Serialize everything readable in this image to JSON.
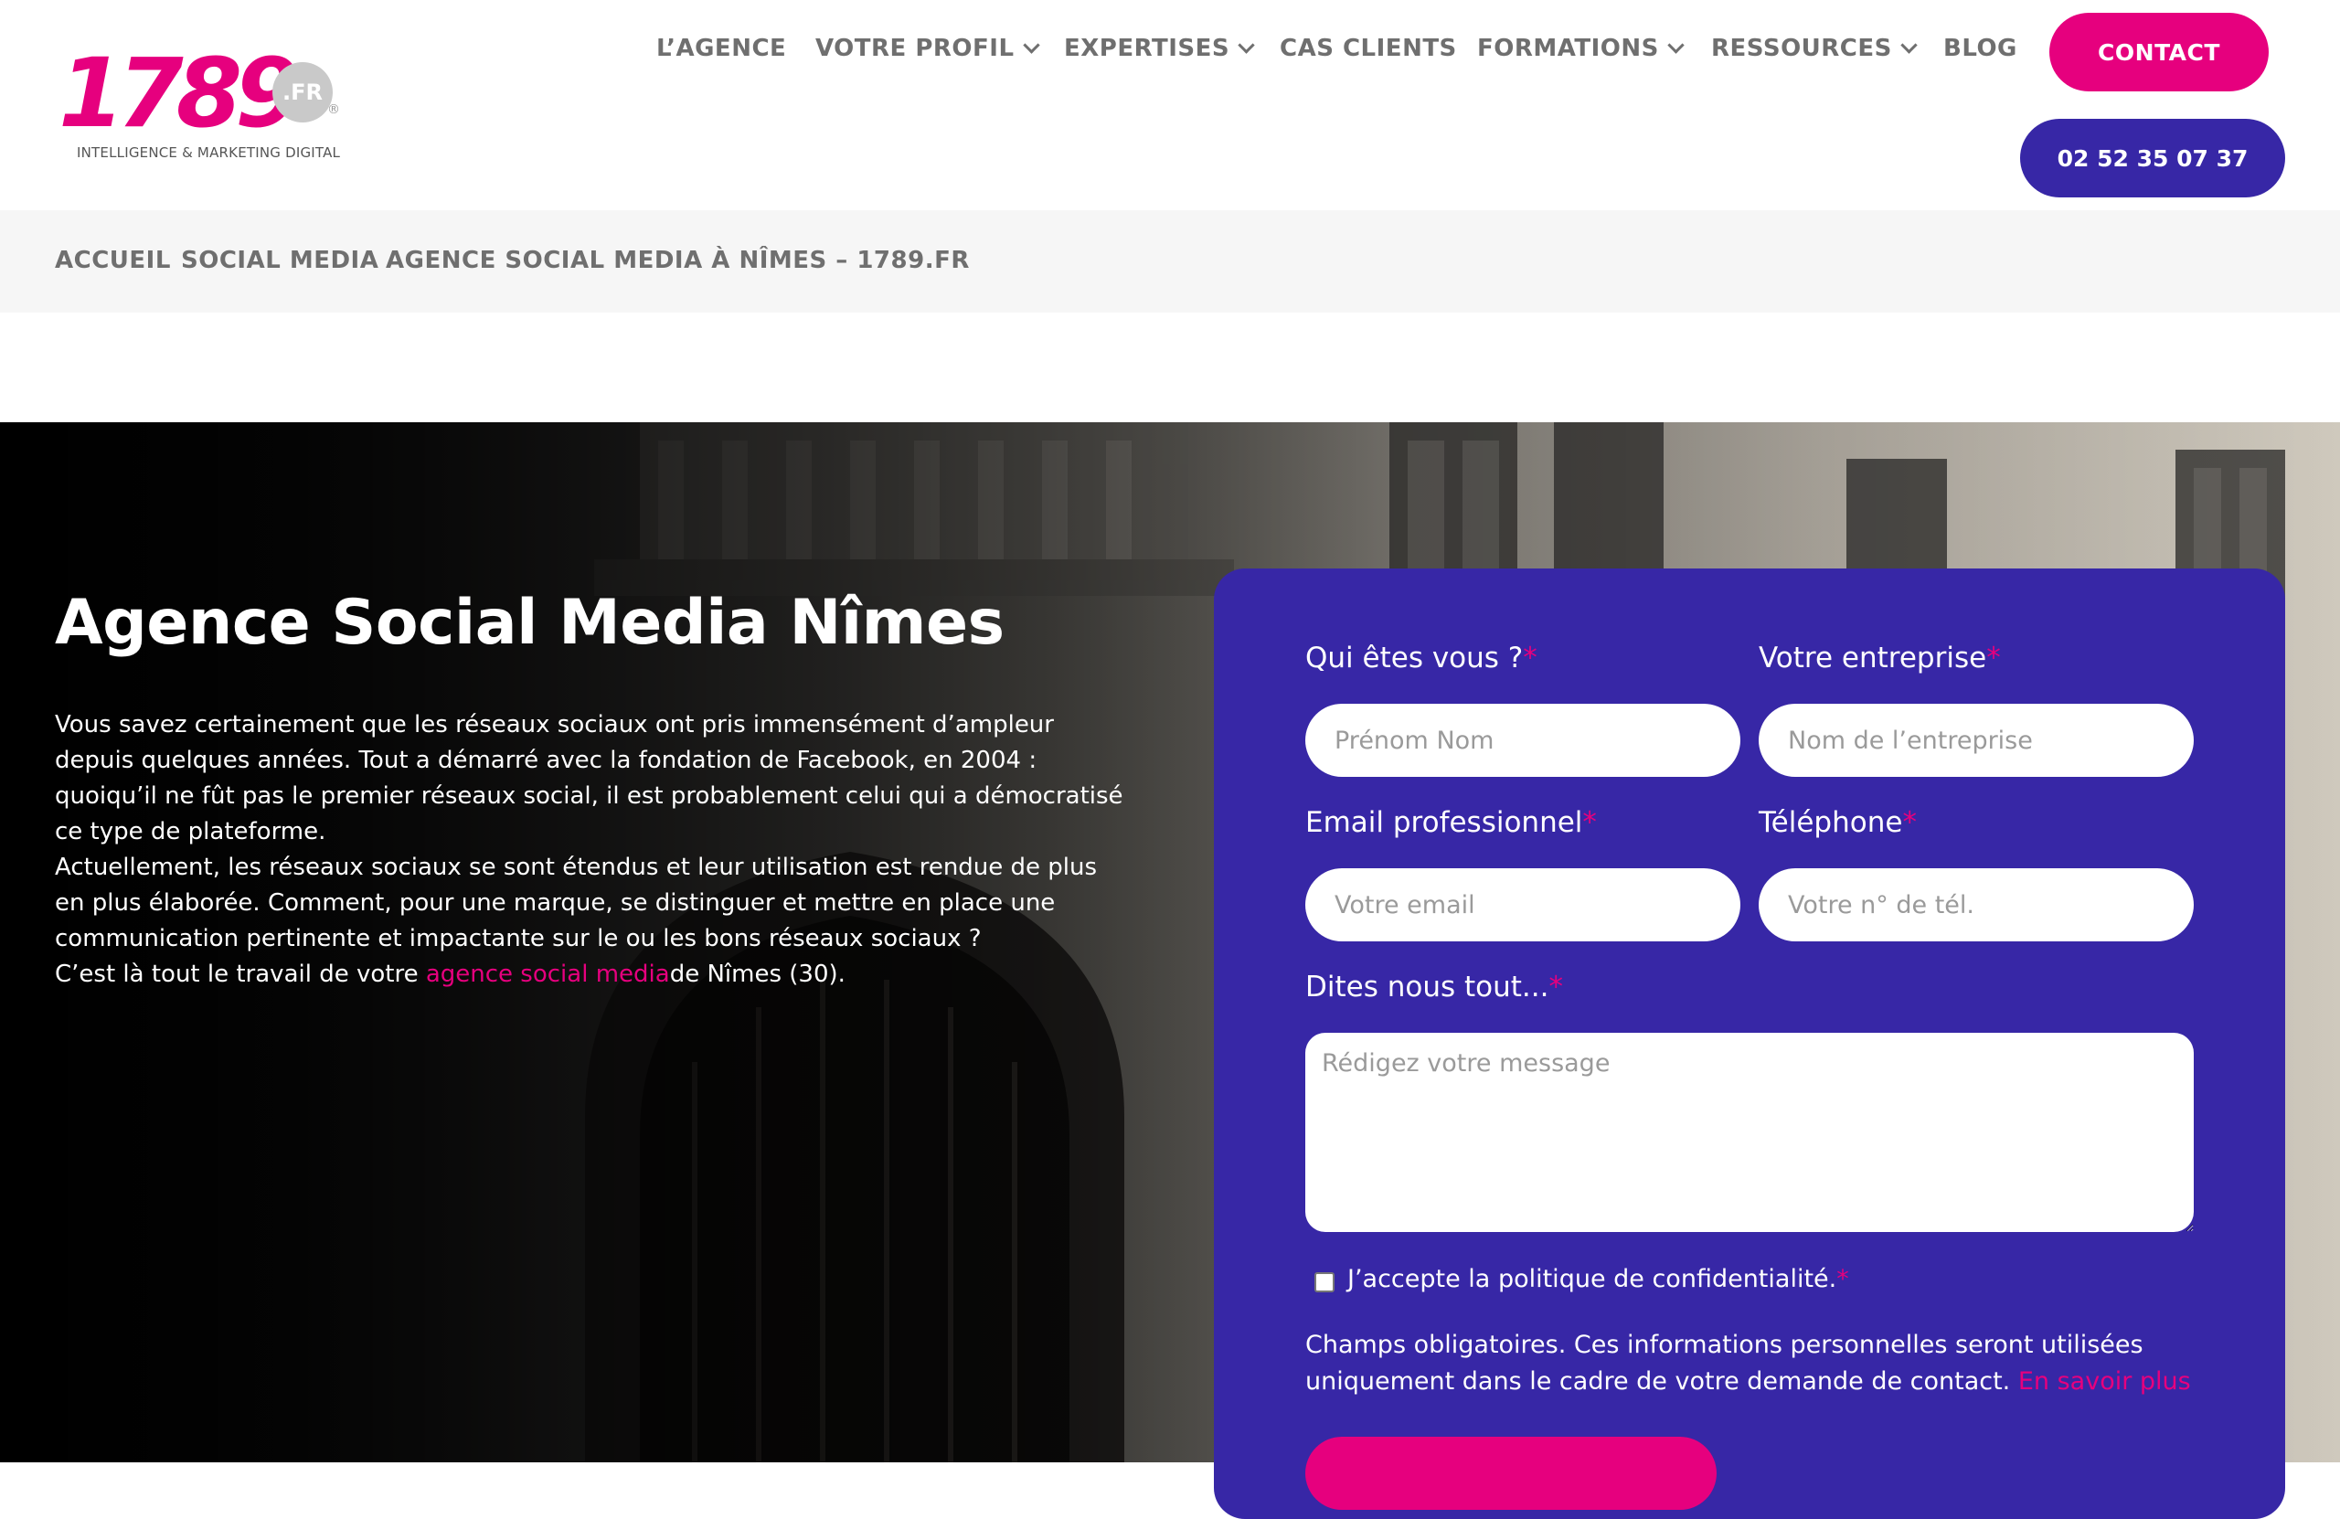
{
  "logo": {
    "number": "1789",
    "badge": ".FR",
    "registered": "®",
    "tagline": "INTELLIGENCE & MARKETING DIGITAL"
  },
  "nav": {
    "items": [
      {
        "label": "L’AGENCE",
        "dropdown": false
      },
      {
        "label": "VOTRE PROFIL",
        "dropdown": true
      },
      {
        "label": "EXPERTISES",
        "dropdown": true
      },
      {
        "label": "CAS CLIENTS",
        "dropdown": false
      },
      {
        "label": "FORMATIONS",
        "dropdown": true
      },
      {
        "label": "RESSOURCES",
        "dropdown": true
      },
      {
        "label": "BLOG",
        "dropdown": false
      }
    ],
    "contact_label": "CONTACT",
    "phone_label": "02 52 35 07 37"
  },
  "breadcrumb": {
    "items": [
      "ACCUEIL",
      "SOCIAL MEDIA",
      "AGENCE SOCIAL MEDIA À NÎMES – 1789.FR"
    ]
  },
  "hero": {
    "title": "Agence Social Media Nîmes",
    "para1": "Vous savez certainement que les réseaux sociaux ont pris immensément d’ampleur depuis quelques années. Tout a démarré avec la fondation de Facebook, en 2004 : quoiqu’il ne fût pas le premier réseaux social, il est probablement celui qui a démocratisé ce type de plateforme.",
    "para2": "Actuellement, les réseaux sociaux se sont étendus et leur utilisation est rendue de plus en plus élaborée. Comment, pour une marque, se distinguer et mettre en place une communication pertinente et impactante sur le ou les bons réseaux sociaux ?",
    "para3_before": "C’est là tout le travail de votre ",
    "para3_link": "agence social media",
    "para3_after": "de Nîmes (30)."
  },
  "form": {
    "required_mark": "*",
    "name_label": "Qui êtes vous ?",
    "name_placeholder": "Prénom Nom",
    "company_label": "Votre entreprise",
    "company_placeholder": "Nom de l’entreprise",
    "email_label": "Email professionnel",
    "email_placeholder": "Votre email",
    "phone_label": "Téléphone",
    "phone_placeholder": "Votre n° de tél.",
    "message_label": "Dites nous tout...",
    "message_placeholder": "Rédigez votre message",
    "consent_label": "J’accepte la politique de confidentialité.",
    "legal_text": "Champs obligatoires. Ces informations personnelles seront utilisées uniquement dans le cadre de votre demande de contact. ",
    "legal_link": "En savoir plus"
  },
  "colors": {
    "brand_pink": "#e6007e",
    "brand_indigo": "#3727a6",
    "nav_gray": "#6f6f6f"
  }
}
